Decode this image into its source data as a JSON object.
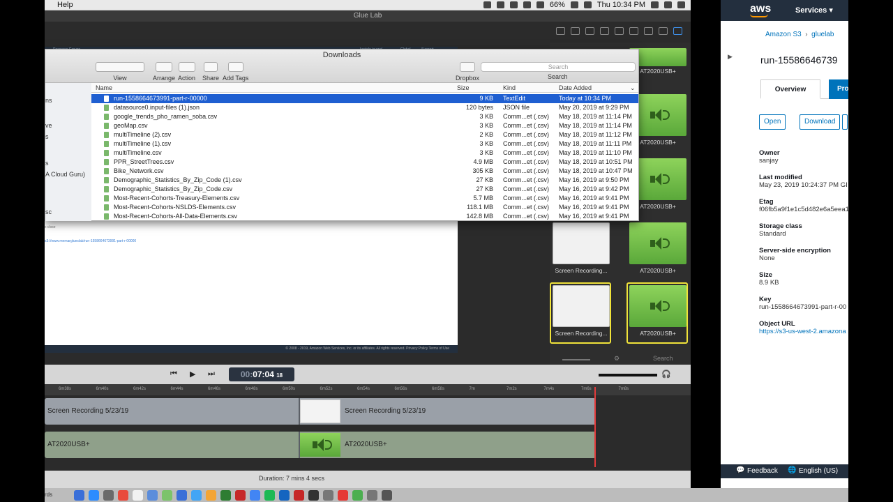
{
  "menubar": {
    "help": "Help",
    "battery": "66%",
    "clock": "Thu 10:34 PM"
  },
  "app": {
    "title": "Glue Lab",
    "canvas_links": {
      "resource_groups": "Resource Groups",
      "account": "kostolo journal",
      "region": "Global",
      "support": "Support"
    },
    "canvas_smalltext": "x close",
    "canvas_link": "s3://www.memarglueslab/run-1558664673991-part-r-00000",
    "canvas_footer": "© 2008 - 2019, Amazon Web Services, Inc. or its affiliates. All rights reserved.   Privacy Policy   Terms of Use",
    "media_search_placeholder": "Search",
    "timecode": {
      "dim": "00:",
      "main": "07:04",
      "frames": "18"
    },
    "ruler": [
      "6m38s",
      "6m40s",
      "6m42s",
      "6m44s",
      "6m46s",
      "6m48s",
      "6m50s",
      "6m52s",
      "6m54s",
      "6m56s",
      "6m58s",
      "7m",
      "7m2s",
      "7m4s",
      "7m6s",
      "7m8s"
    ],
    "track_video_label": "Screen Recording 5/23/19",
    "track_audio_label": "AT2020USB+",
    "duration": "Duration: 7 mins 4 secs"
  },
  "media": [
    {
      "caption": "AT2020USB+",
      "type": "audio"
    },
    {
      "caption": "AT2020USB+",
      "type": "audio"
    },
    {
      "caption": "AT2020USB+",
      "type": "audio"
    },
    {
      "caption": "Screen Recording...",
      "type": "video"
    },
    {
      "caption": "AT2020USB+",
      "type": "audio"
    },
    {
      "caption": "Screen Recording...",
      "type": "video"
    },
    {
      "caption": "AT2020USB+",
      "type": "audio"
    }
  ],
  "finder": {
    "title": "Downloads",
    "toolbar": {
      "view": "View",
      "arrange": "Arrange",
      "action": "Action",
      "share": "Share",
      "add_tags": "Add Tags",
      "dropbox": "Dropbox",
      "search": "Search",
      "search_placeholder": "Search"
    },
    "sidebar": [
      "ns",
      "ve",
      "s",
      "s",
      "A Cloud Guru)",
      "sc"
    ],
    "columns": {
      "name": "Name",
      "size": "Size",
      "kind": "Kind",
      "date": "Date Added"
    },
    "rows": [
      {
        "name": "run-1558664673991-part-r-00000",
        "size": "9 KB",
        "kind": "TextEdit",
        "date": "Today at 10:34 PM"
      },
      {
        "name": "datasource0.input-files (1).json",
        "size": "120 bytes",
        "kind": "JSON file",
        "date": "May 20, 2019 at 9:29 PM"
      },
      {
        "name": "google_trends_pho_ramen_soba.csv",
        "size": "3 KB",
        "kind": "Comm...et (.csv)",
        "date": "May 18, 2019 at 11:14 PM"
      },
      {
        "name": "geoMap.csv",
        "size": "3 KB",
        "kind": "Comm...et (.csv)",
        "date": "May 18, 2019 at 11:14 PM"
      },
      {
        "name": "multiTimeline (2).csv",
        "size": "2 KB",
        "kind": "Comm...et (.csv)",
        "date": "May 18, 2019 at 11:12 PM"
      },
      {
        "name": "multiTimeline (1).csv",
        "size": "3 KB",
        "kind": "Comm...et (.csv)",
        "date": "May 18, 2019 at 11:11 PM"
      },
      {
        "name": "multiTimeline.csv",
        "size": "3 KB",
        "kind": "Comm...et (.csv)",
        "date": "May 18, 2019 at 11:10 PM"
      },
      {
        "name": "PPR_StreetTrees.csv",
        "size": "4.9 MB",
        "kind": "Comm...et (.csv)",
        "date": "May 18, 2019 at 10:51 PM"
      },
      {
        "name": "Bike_Network.csv",
        "size": "305 KB",
        "kind": "Comm...et (.csv)",
        "date": "May 18, 2019 at 10:47 PM"
      },
      {
        "name": "Demographic_Statistics_By_Zip_Code (1).csv",
        "size": "27 KB",
        "kind": "Comm...et (.csv)",
        "date": "May 16, 2019 at 9:50 PM"
      },
      {
        "name": "Demographic_Statistics_By_Zip_Code.csv",
        "size": "27 KB",
        "kind": "Comm...et (.csv)",
        "date": "May 16, 2019 at 9:42 PM"
      },
      {
        "name": "Most-Recent-Cohorts-Treasury-Elements.csv",
        "size": "5.7 MB",
        "kind": "Comm...et (.csv)",
        "date": "May 16, 2019 at 9:41 PM"
      },
      {
        "name": "Most-Recent-Cohorts-NSLDS-Elements.csv",
        "size": "118.1 MB",
        "kind": "Comm...et (.csv)",
        "date": "May 16, 2019 at 9:41 PM"
      },
      {
        "name": "Most-Recent-Cohorts-All-Data-Elements.csv",
        "size": "142.8 MB",
        "kind": "Comm...et (.csv)",
        "date": "May 16, 2019 at 9:41 PM"
      }
    ]
  },
  "aws": {
    "logo": "aws",
    "services": "Services",
    "crumb_s3": "Amazon S3",
    "crumb_bucket": "gluelab",
    "object_name": "run-15586646739",
    "tab_overview": "Overview",
    "tab_properties": "Prop",
    "btn_open": "Open",
    "btn_download": "Download",
    "props": [
      {
        "k": "Owner",
        "v": "sanjay"
      },
      {
        "k": "Last modified",
        "v": "May 23, 2019 10:24:37 PM GI"
      },
      {
        "k": "Etag",
        "v": "f06fb5a9f1e1c5d482e6a5eea1"
      },
      {
        "k": "Storage class",
        "v": "Standard"
      },
      {
        "k": "Server-side encryption",
        "v": "None"
      },
      {
        "k": "Size",
        "v": "8.9 KB"
      },
      {
        "k": "Key",
        "v": "run-1558664673991-part-r-00"
      },
      {
        "k": "Object URL",
        "v": "https://s3-us-west-2.amazona",
        "link": true
      }
    ],
    "feedback": "Feedback",
    "language": "English (US)"
  },
  "dock": {
    "label": "rds"
  }
}
